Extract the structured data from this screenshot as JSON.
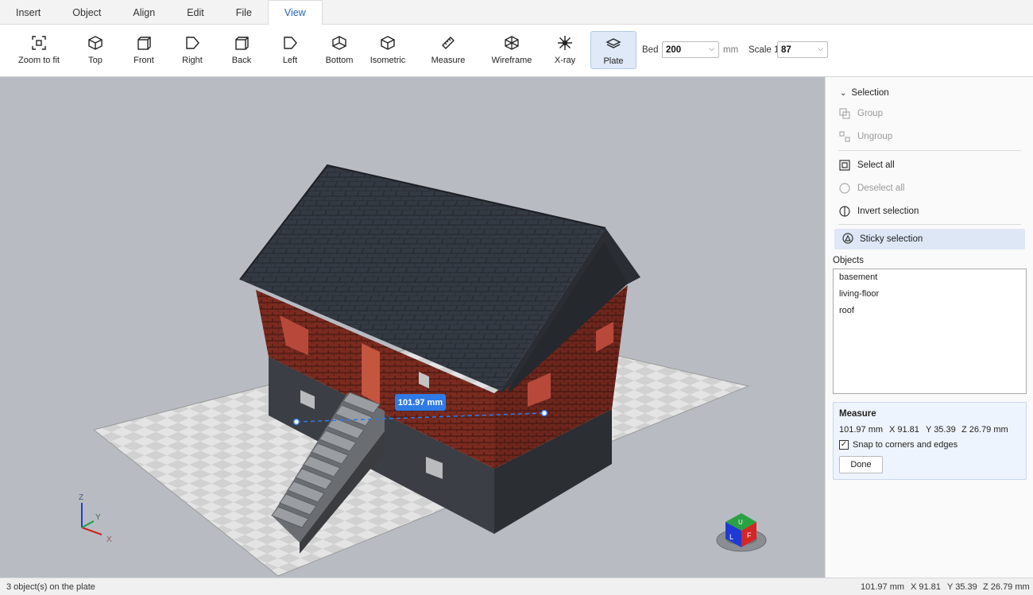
{
  "menu": {
    "tabs": [
      {
        "label": "Insert"
      },
      {
        "label": "Object"
      },
      {
        "label": "Align"
      },
      {
        "label": "Edit"
      },
      {
        "label": "File"
      },
      {
        "label": "View"
      }
    ],
    "active": "View"
  },
  "toolbar": {
    "tools": [
      {
        "label": "Zoom to fit",
        "icon": "zoom-to-fit-icon"
      },
      {
        "label": "Top",
        "icon": "view-top-icon"
      },
      {
        "label": "Front",
        "icon": "view-front-icon"
      },
      {
        "label": "Right",
        "icon": "view-right-icon"
      },
      {
        "label": "Back",
        "icon": "view-back-icon"
      },
      {
        "label": "Left",
        "icon": "view-left-icon"
      },
      {
        "label": "Bottom",
        "icon": "view-bottom-icon"
      },
      {
        "label": "Isometric",
        "icon": "view-isometric-icon"
      },
      {
        "label": "Measure",
        "icon": "ruler-icon"
      },
      {
        "label": "Wireframe",
        "icon": "wireframe-cube-icon"
      },
      {
        "label": "X-ray",
        "icon": "xray-icon"
      },
      {
        "label": "Plate",
        "icon": "plate-icon",
        "pressed": true
      }
    ],
    "bed_label": "Bed",
    "bed_value": "200",
    "bed_unit": "mm",
    "scale_label": "Scale 1:",
    "scale_value": "87"
  },
  "viewport": {
    "measure_badge": "101.97 mm",
    "axes": {
      "z": "Z",
      "y": "Y",
      "x": "X"
    },
    "colors": {
      "background": "#b8bcc2",
      "roof": "#2e333b",
      "brick": "#7a2a1f",
      "basement": "#3a3d42",
      "accent": "#2f7be5"
    }
  },
  "panel": {
    "selection_header": "Selection",
    "group": "Group",
    "ungroup": "Ungroup",
    "select_all": "Select all",
    "deselect_all": "Deselect all",
    "invert_selection": "Invert selection",
    "sticky_selection": "Sticky selection",
    "objects_header": "Objects",
    "objects": [
      "basement",
      "living-floor",
      "roof"
    ],
    "measure": {
      "title": "Measure",
      "distance": "101.97 mm",
      "x": "X 91.81",
      "y": "Y 35.39",
      "z": "Z 26.79 mm",
      "snap_label": "Snap to corners and edges",
      "snap_checked": true,
      "done_label": "Done"
    }
  },
  "status": {
    "left": "3 object(s) on the plate",
    "distance": "101.97 mm",
    "x": "X 91.81",
    "y": "Y 35.39",
    "z": "Z 26.79 mm"
  }
}
